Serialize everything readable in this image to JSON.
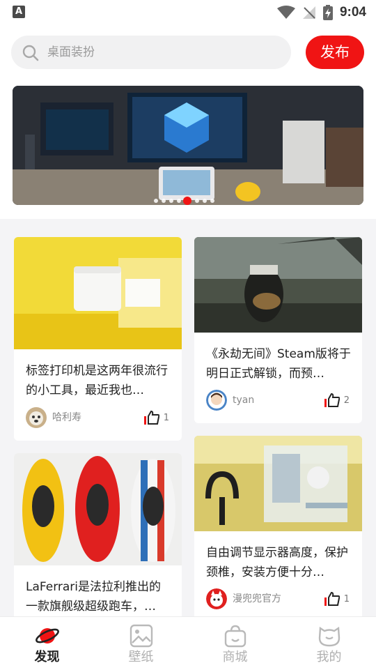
{
  "status_bar": {
    "time": "9:04",
    "left_icon": "A"
  },
  "search": {
    "placeholder": "桌面装扮",
    "icon": "search-icon"
  },
  "publish_label": "发布",
  "banner": {
    "dots": 8,
    "active_dot": 5
  },
  "feed": {
    "left": [
      {
        "title": "标签打印机是这两年很流行的小工具，最近我也…",
        "author": "哈利寿",
        "likes": "1"
      },
      {
        "title": "LaFerrari是法拉利推出的一款旗舰级超级跑车，…",
        "author": "",
        "likes": ""
      }
    ],
    "right": [
      {
        "title": "《永劫无间》Steam版将于明日正式解锁，而预…",
        "author": "tyan",
        "likes": "2"
      },
      {
        "title": "自由调节显示器高度，保护颈椎，安装方便十分…",
        "author": "漫兜兜官方",
        "likes": "1"
      }
    ]
  },
  "tabs": [
    {
      "label": "发现",
      "icon": "planet-icon",
      "active": true
    },
    {
      "label": "壁纸",
      "icon": "image-icon",
      "active": false
    },
    {
      "label": "商城",
      "icon": "shopping-bag-icon",
      "active": false
    },
    {
      "label": "我的",
      "icon": "cat-face-icon",
      "active": false
    }
  ],
  "colors": {
    "accent": "#f01414",
    "background": "#f4f4f6"
  }
}
